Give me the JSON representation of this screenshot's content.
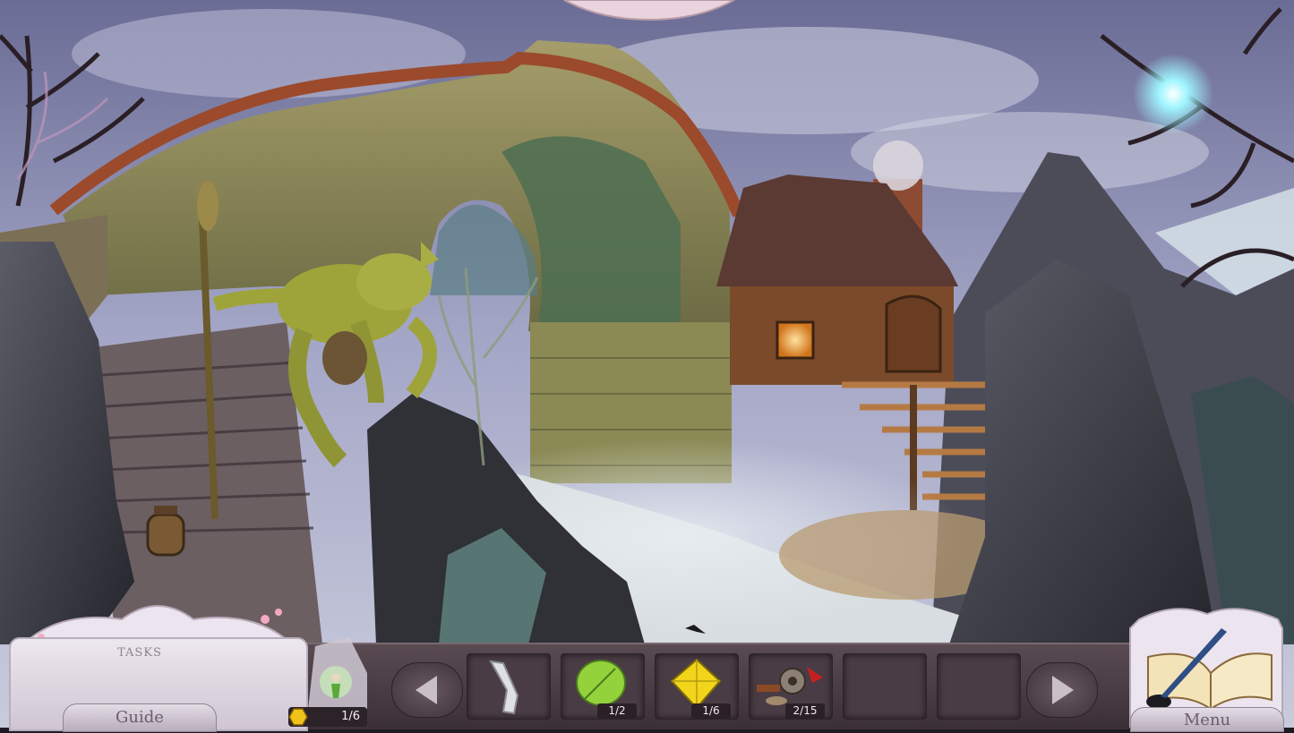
{
  "hud": {
    "tasks_label": "TASKS",
    "guide_label": "Guide",
    "menu_label": "Menu",
    "hint_count": "1/6"
  },
  "inventory": [
    {
      "icon": "stone-shard-icon",
      "count": ""
    },
    {
      "icon": "green-leaf-icon",
      "count": "1/2"
    },
    {
      "icon": "yellow-gem-icon",
      "count": "1/6"
    },
    {
      "icon": "gear-parts-icon",
      "count": "2/15"
    },
    {
      "icon": "empty-slot",
      "count": ""
    },
    {
      "icon": "empty-slot",
      "count": ""
    }
  ],
  "colors": {
    "sky": "#8f8fb4",
    "stone": "#8a8458",
    "bridge_moss": "#4d6e52",
    "goblin": "#9ea43a",
    "hut_wood": "#6e3f25",
    "window_glow": "#ffb54a",
    "fairy_glow": "#9ff5ff"
  }
}
